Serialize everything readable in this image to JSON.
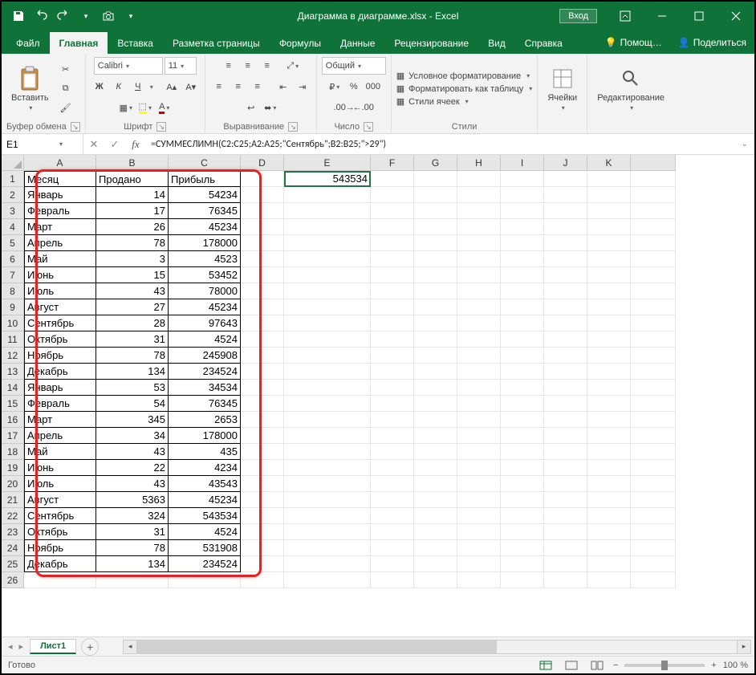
{
  "titlebar": {
    "title": "Диаграмма в диаграмме.xlsx - Excel",
    "login": "Вход"
  },
  "tabs": {
    "file": "Файл",
    "home": "Главная",
    "insert": "Вставка",
    "page_layout": "Разметка страницы",
    "formulas": "Формулы",
    "data": "Данные",
    "review": "Рецензирование",
    "view": "Вид",
    "help": "Справка",
    "tell_me": "Помощ…",
    "share": "Поделиться"
  },
  "ribbon": {
    "clipboard": {
      "label": "Буфер обмена",
      "paste": "Вставить"
    },
    "font": {
      "label": "Шрифт",
      "name": "Calibri",
      "size": "11",
      "bold": "Ж",
      "italic": "К",
      "underline": "Ч"
    },
    "alignment": {
      "label": "Выравнивание"
    },
    "number": {
      "label": "Число",
      "format": "Общий"
    },
    "styles": {
      "label": "Стили",
      "cond": "Условное форматирование",
      "table": "Форматировать как таблицу",
      "cell_styles": "Стили ячеек"
    },
    "cells": {
      "label": "Ячейки"
    },
    "editing": {
      "label": "Редактирование"
    }
  },
  "formula_bar": {
    "name": "E1",
    "formula": "=СУММЕСЛИМН(C2:C25;A2:A25;\"Сентябрь\";B2:B25;\">29\")"
  },
  "columns": [
    "A",
    "B",
    "C",
    "D",
    "E",
    "F",
    "G",
    "H",
    "I",
    "J",
    "K"
  ],
  "headers": {
    "a": "Месяц",
    "b": "Продано",
    "c": "Прибыль"
  },
  "result_e1": "543534",
  "rows": [
    {
      "a": "Январь",
      "b": "14",
      "c": "54234"
    },
    {
      "a": "Февраль",
      "b": "17",
      "c": "76345"
    },
    {
      "a": "Март",
      "b": "26",
      "c": "45234"
    },
    {
      "a": "Апрель",
      "b": "78",
      "c": "178000"
    },
    {
      "a": "Май",
      "b": "3",
      "c": "4523"
    },
    {
      "a": "Июнь",
      "b": "15",
      "c": "53452"
    },
    {
      "a": "Июль",
      "b": "43",
      "c": "78000"
    },
    {
      "a": "Август",
      "b": "27",
      "c": "45234"
    },
    {
      "a": "Сентябрь",
      "b": "28",
      "c": "97643"
    },
    {
      "a": "Октябрь",
      "b": "31",
      "c": "4524"
    },
    {
      "a": "Ноябрь",
      "b": "78",
      "c": "245908"
    },
    {
      "a": "Декабрь",
      "b": "134",
      "c": "234524"
    },
    {
      "a": "Январь",
      "b": "53",
      "c": "34534"
    },
    {
      "a": "Февраль",
      "b": "54",
      "c": "76345"
    },
    {
      "a": "Март",
      "b": "345",
      "c": "2653"
    },
    {
      "a": "Апрель",
      "b": "34",
      "c": "178000"
    },
    {
      "a": "Май",
      "b": "43",
      "c": "435"
    },
    {
      "a": "Июнь",
      "b": "22",
      "c": "4234"
    },
    {
      "a": "Июль",
      "b": "43",
      "c": "43543"
    },
    {
      "a": "Август",
      "b": "5363",
      "c": "45234"
    },
    {
      "a": "Сентябрь",
      "b": "324",
      "c": "543534"
    },
    {
      "a": "Октябрь",
      "b": "31",
      "c": "4524"
    },
    {
      "a": "Ноябрь",
      "b": "78",
      "c": "531908"
    },
    {
      "a": "Декабрь",
      "b": "134",
      "c": "234524"
    }
  ],
  "sheets": {
    "sheet1": "Лист1"
  },
  "status": {
    "ready": "Готово",
    "zoom": "100 %"
  }
}
